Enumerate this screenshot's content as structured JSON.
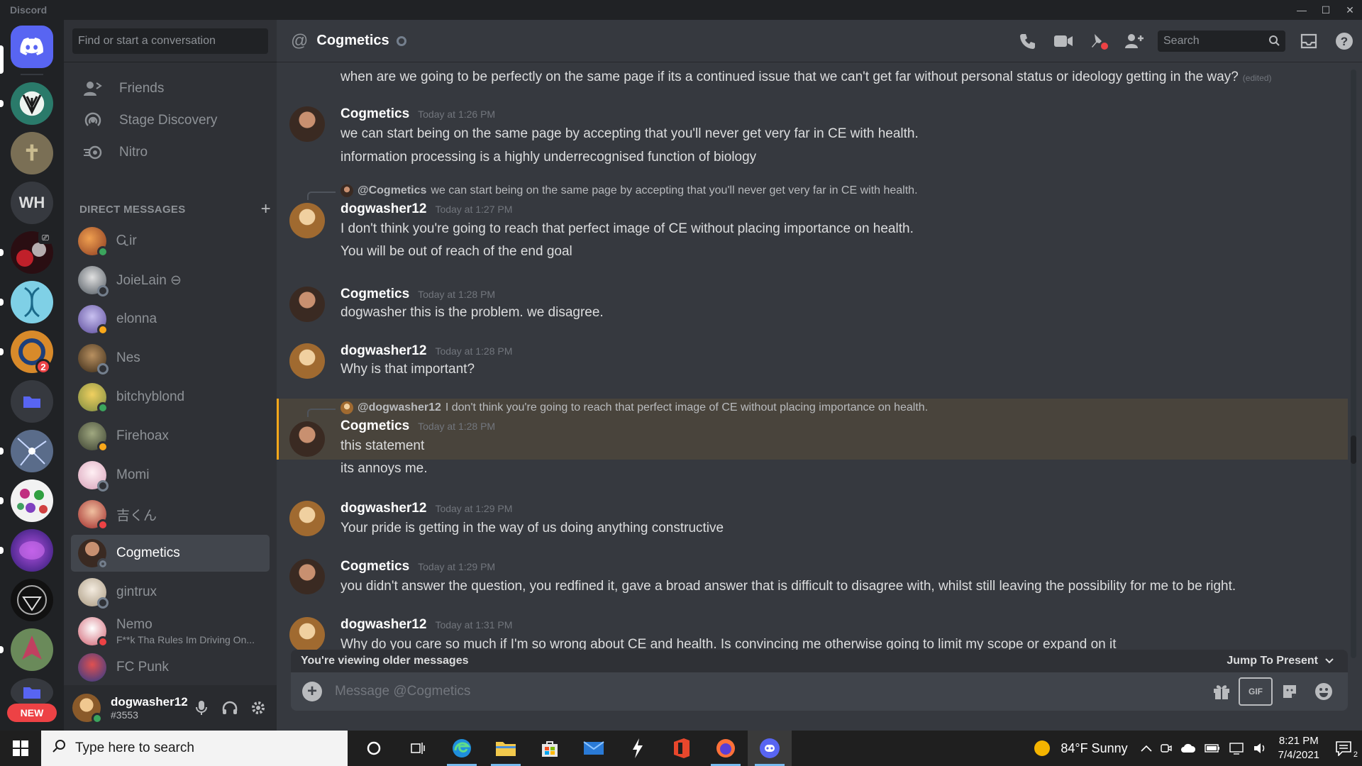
{
  "window": {
    "app_name": "Discord"
  },
  "rail": {
    "servers": [
      {
        "label": "",
        "name": "discord-home"
      },
      {
        "label": "",
        "name": "server-1"
      },
      {
        "label": "",
        "name": "server-2"
      },
      {
        "label": "WH",
        "name": "server-wh"
      },
      {
        "label": "",
        "name": "server-4"
      },
      {
        "label": "",
        "name": "server-5"
      },
      {
        "label": "",
        "name": "server-6"
      },
      {
        "label": "",
        "name": "folder"
      },
      {
        "label": "",
        "name": "server-8"
      },
      {
        "label": "",
        "name": "server-9"
      },
      {
        "label": "",
        "name": "server-10"
      },
      {
        "label": "",
        "name": "server-11"
      },
      {
        "label": "",
        "name": "server-12"
      }
    ],
    "badge_count": "2",
    "new_label": "NEW"
  },
  "sidebar": {
    "search_placeholder": "Find or start a conversation",
    "nav": [
      {
        "label": "Friends"
      },
      {
        "label": "Stage Discovery"
      },
      {
        "label": "Nitro"
      }
    ],
    "dm_header": "DIRECT MESSAGES",
    "dms": [
      {
        "name": "Ꮹir",
        "status": "online",
        "color": "#e07b39"
      },
      {
        "name": "JoieLain ⊖",
        "status": "offline",
        "color": "#9aa0a8"
      },
      {
        "name": "elonna",
        "status": "idle",
        "color": "#8a7fcf"
      },
      {
        "name": "Nes",
        "status": "offline",
        "color": "#6b5a3e"
      },
      {
        "name": "bitchyblond",
        "status": "online",
        "color": "#d4b24a"
      },
      {
        "name": "Firehoax",
        "status": "idle",
        "color": "#6a7550"
      },
      {
        "name": "Momi",
        "status": "offline",
        "color": "#e6b8c8"
      },
      {
        "name": "吉くん",
        "status": "dnd",
        "color": "#b83a3a"
      },
      {
        "name": "Cogmetics",
        "status": "offline",
        "color": "#4a3a30"
      },
      {
        "name": "gintrux",
        "status": "offline",
        "color": "#c8c0b0"
      },
      {
        "name": "Nemo",
        "sub": "F**k Tha Rules Im Driving On...",
        "status": "dnd",
        "color": "#d05060"
      },
      {
        "name": "FC Punk",
        "status": "offline",
        "color": "#5560a0"
      }
    ],
    "user": {
      "name": "dogwasher12",
      "tag": "#3553"
    }
  },
  "channel": {
    "name": "Cogmetics",
    "search_placeholder": "Search"
  },
  "messages": {
    "m0": {
      "text": "when are we going to be perfectly on the same page if its a continued issue that we can't get far without personal status or ideology getting in the way?",
      "edited": "(edited)"
    },
    "m1": {
      "author": "Cogmetics",
      "time": "Today at 1:26 PM",
      "l1": "we can start being on the same page by accepting that you'll never get very far in CE with health.",
      "l2": "information processing is a highly underrecognised function of biology"
    },
    "m2": {
      "reply_mention": "@Cogmetics",
      "reply_text": "we can start being on the same page by accepting that you'll never get very far in CE with health.",
      "author": "dogwasher12",
      "time": "Today at 1:27 PM",
      "l1": "I don't think you're going to reach that perfect image of CE without placing importance on health.",
      "l2": "You will be out of reach of the end goal"
    },
    "m3": {
      "author": "Cogmetics",
      "time": "Today at 1:28 PM",
      "l1": "dogwasher this is the problem. we disagree."
    },
    "m4": {
      "author": "dogwasher12",
      "time": "Today at 1:28 PM",
      "l1": "Why is that important?"
    },
    "m5": {
      "reply_mention": "@dogwasher12",
      "reply_text": "I don't think you're going to reach that perfect image of CE without placing importance on health.",
      "author": "Cogmetics",
      "time": "Today at 1:28 PM",
      "l1": "this statement",
      "l2": "its annoys me."
    },
    "m6": {
      "author": "dogwasher12",
      "time": "Today at 1:29 PM",
      "l1": "Your pride is getting in the way of us doing anything constructive"
    },
    "m7": {
      "author": "Cogmetics",
      "time": "Today at 1:29 PM",
      "l1": "you didn't answer the question, you redfined it, gave a broad answer that is difficult to disagree with, whilst still leaving the possibility for me to be right."
    },
    "m8": {
      "author": "dogwasher12",
      "time": "Today at 1:31 PM",
      "l1": "Why do you care so much if I'm so wrong about CE and health. Is convincing me otherwise going to limit my scope or expand on it"
    }
  },
  "older_bar": {
    "text": "You're viewing older messages",
    "jump": "Jump To Present"
  },
  "composer": {
    "placeholder": "Message @Cogmetics",
    "gif": "GIF"
  },
  "taskbar": {
    "search_placeholder": "Type here to search",
    "weather": "84°F  Sunny",
    "time": "8:21 PM",
    "date": "7/4/2021",
    "notif_count": "2"
  }
}
